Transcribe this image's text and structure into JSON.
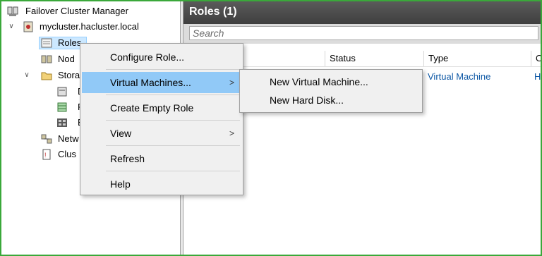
{
  "tree": {
    "root_label": "Failover Cluster Manager",
    "cluster_label": "mycluster.hacluster.local",
    "roles_label": "Roles",
    "nodes_label": "Nod",
    "storage_label": "Stora",
    "disks_label": "D",
    "pools_label": "P",
    "enclosures_label": "E",
    "networks_label": "Netw",
    "cluster_events_label": "Clus"
  },
  "main": {
    "title": "Roles (1)",
    "search_placeholder": "Search",
    "columns": [
      "Status",
      "Type",
      "O"
    ],
    "rows": [
      {
        "type": "Virtual Machine",
        "owner": "H"
      }
    ]
  },
  "context_menu": {
    "items": [
      {
        "label": "Configure Role..."
      },
      {
        "label": "Virtual Machines...",
        "arrow": ">"
      },
      {
        "label": "Create Empty Role"
      },
      {
        "label": "View",
        "arrow": ">"
      },
      {
        "label": "Refresh"
      },
      {
        "label": "Help"
      }
    ]
  },
  "submenu": {
    "items": [
      {
        "label": "New Virtual Machine..."
      },
      {
        "label": "New Hard Disk..."
      }
    ]
  },
  "colors": {
    "frame_border": "#3aa83a",
    "highlight": "#91c9f7",
    "header_bg": "#4a4a4a",
    "link_text": "#0b56a4"
  }
}
